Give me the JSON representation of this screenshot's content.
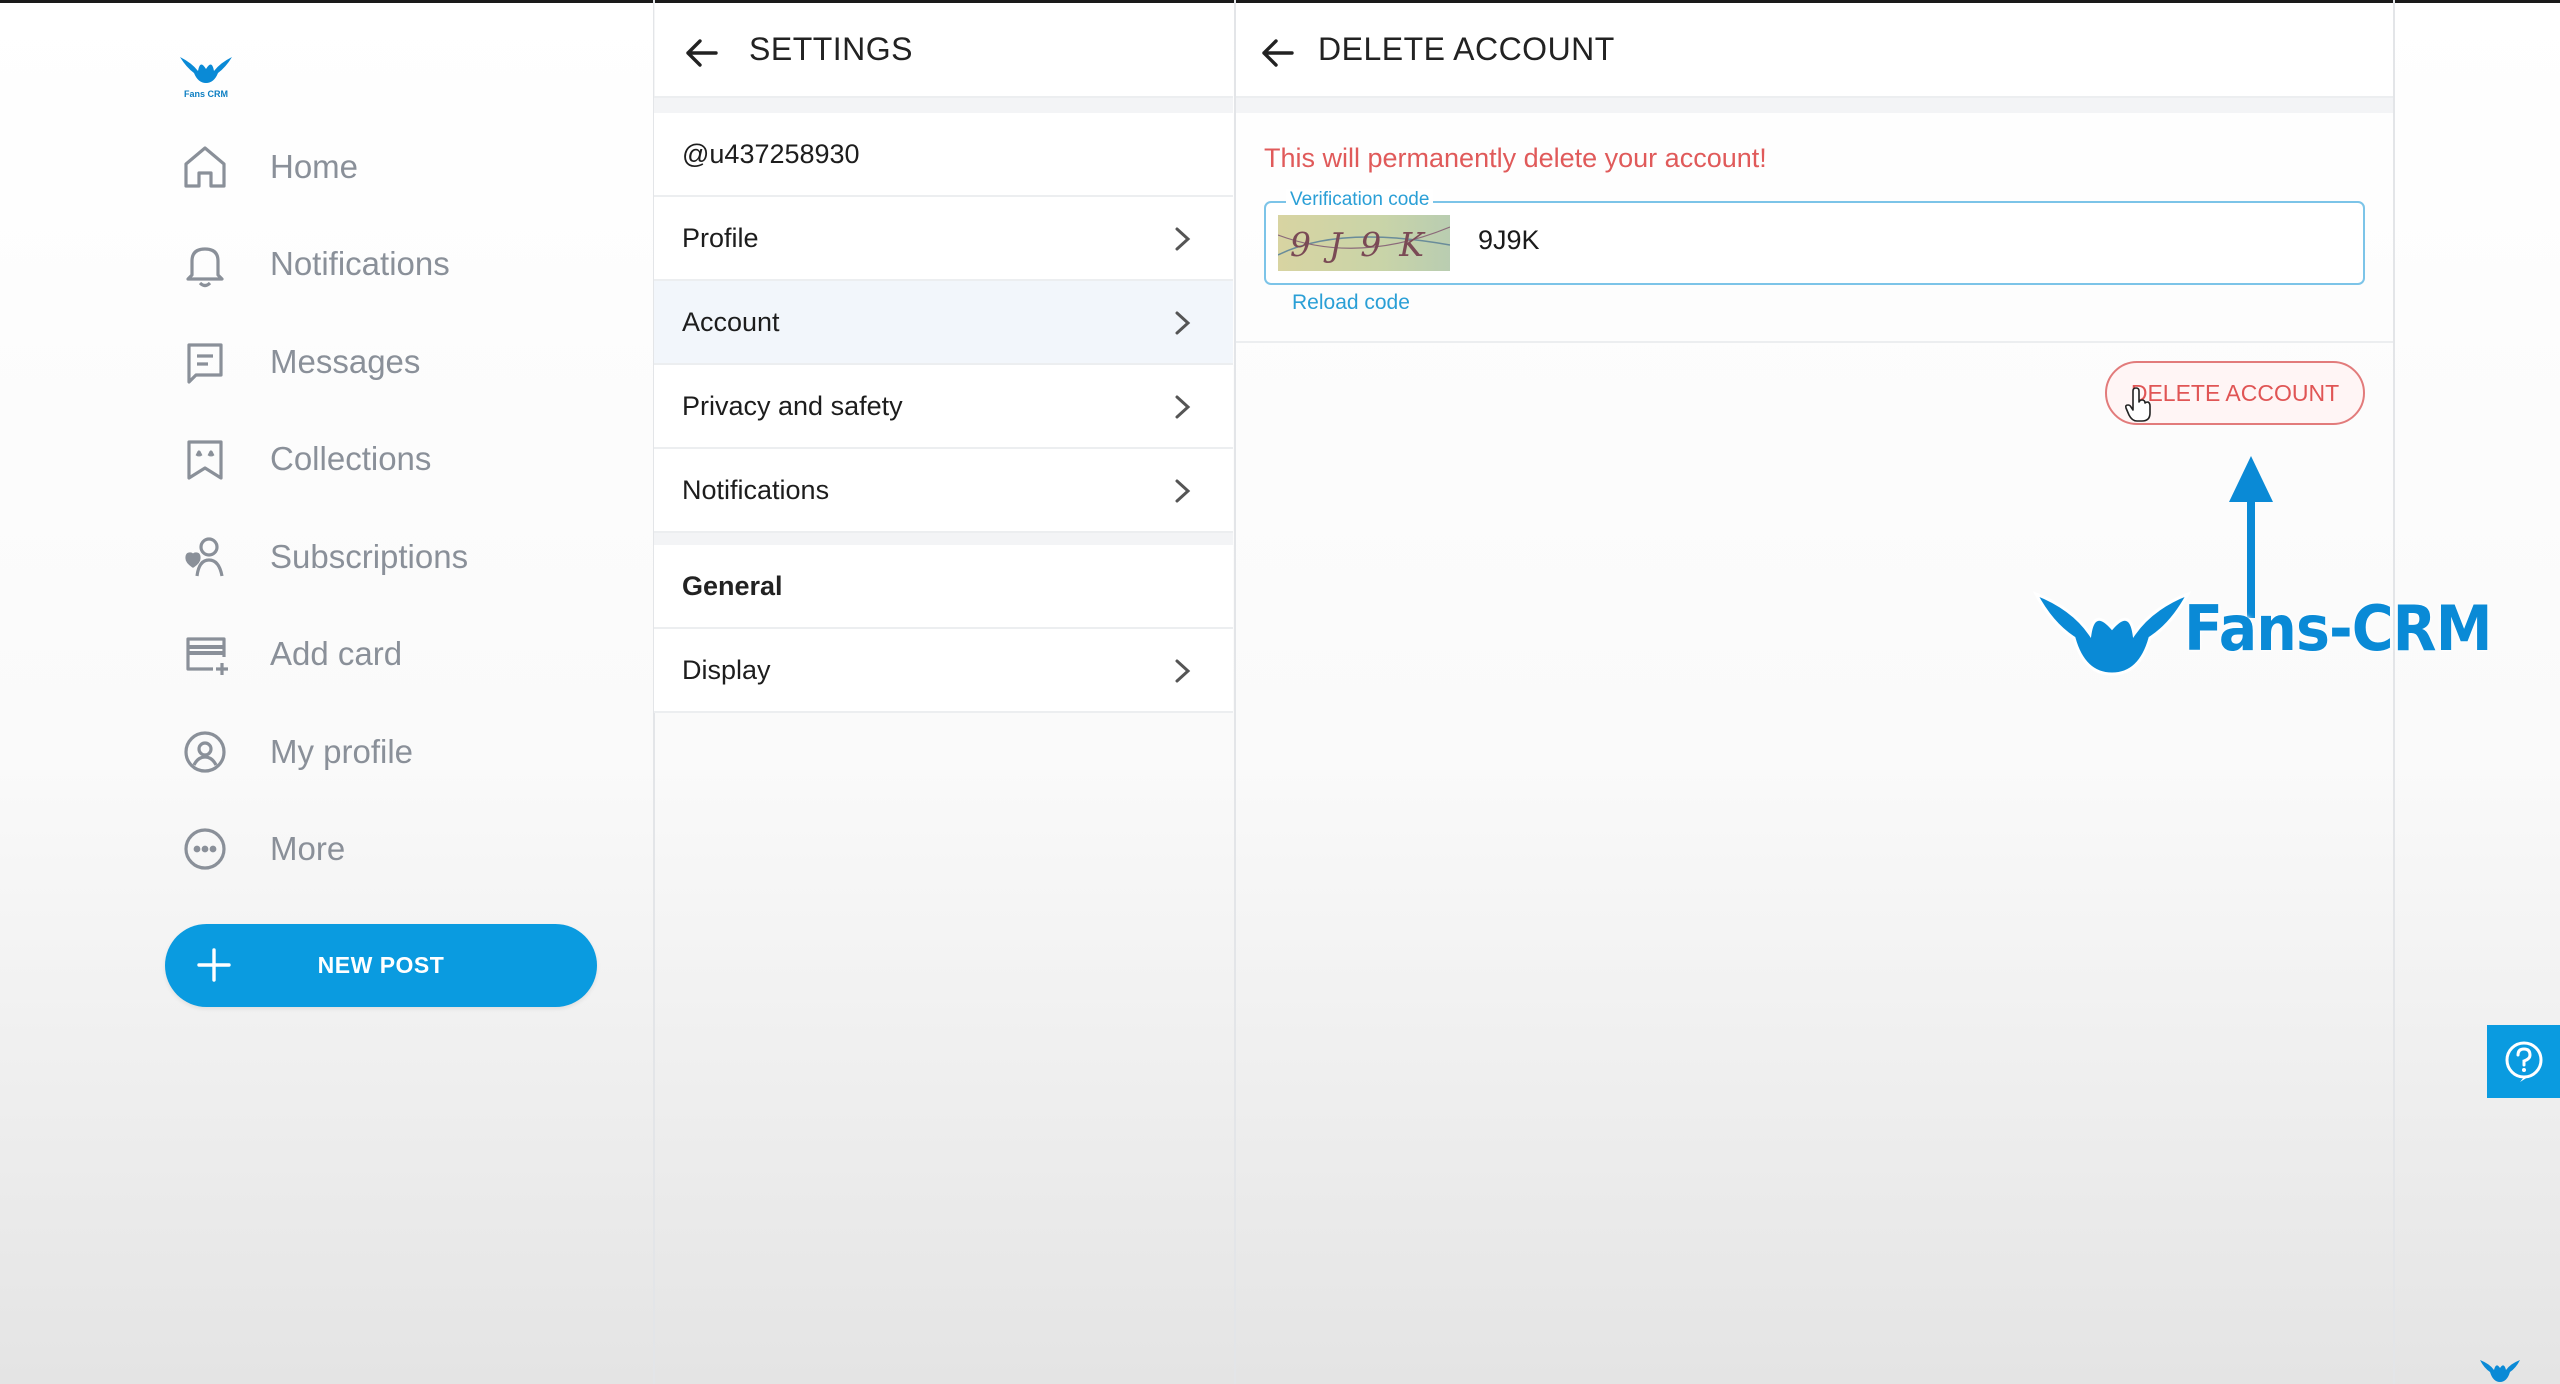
{
  "brand": {
    "logo_text": "Fans CRM"
  },
  "nav": {
    "items": [
      {
        "label": "Home",
        "icon": "home-icon"
      },
      {
        "label": "Notifications",
        "icon": "bell-icon"
      },
      {
        "label": "Messages",
        "icon": "message-icon"
      },
      {
        "label": "Collections",
        "icon": "bookmark-icon"
      },
      {
        "label": "Subscriptions",
        "icon": "user-heart-icon"
      },
      {
        "label": "Add card",
        "icon": "card-add-icon"
      },
      {
        "label": "My profile",
        "icon": "profile-icon"
      },
      {
        "label": "More",
        "icon": "more-icon"
      }
    ],
    "new_post": "NEW POST"
  },
  "settings": {
    "title": "SETTINGS",
    "username": "@u437258930",
    "items": [
      {
        "label": "Profile"
      },
      {
        "label": "Account"
      },
      {
        "label": "Privacy and safety"
      },
      {
        "label": "Notifications"
      }
    ],
    "section_general": "General",
    "general_items": [
      {
        "label": "Display"
      }
    ]
  },
  "delete_account": {
    "title": "DELETE ACCOUNT",
    "warning": "This will permanently delete your account!",
    "verification_label": "Verification code",
    "captcha_text": "9J9K",
    "input_value": "9J9K",
    "reload_label": "Reload code",
    "button_label": "DELETE ACCOUNT"
  },
  "overlay": {
    "brand_text": "Fans-CRM"
  },
  "colors": {
    "accent": "#0a9be0",
    "danger": "#e05a5a",
    "nav_text": "#8a9099"
  }
}
